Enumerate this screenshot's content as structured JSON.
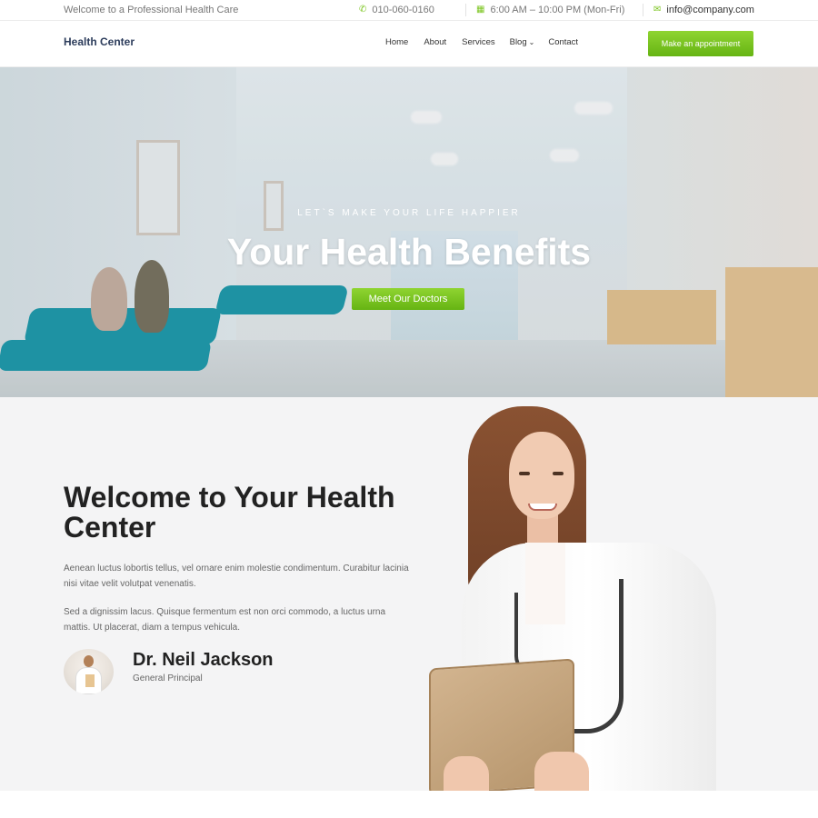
{
  "topbar": {
    "welcome": "Welcome to a Professional Health Care",
    "phone": "010-060-0160",
    "hours": "6:00 AM – 10:00 PM (Mon-Fri)",
    "email": "info@company.com",
    "phone_icon": "phone-icon",
    "calendar_icon": "calendar-icon",
    "mail_icon": "mail-icon"
  },
  "nav": {
    "brand": "Health Center",
    "items": [
      "Home",
      "About",
      "Services",
      "Blog",
      "Contact"
    ],
    "cta": "Make an appointment"
  },
  "hero": {
    "kicker": "LET`S MAKE YOUR LIFE HAPPIER",
    "title": "Your Health Benefits",
    "button": "Meet Our Doctors"
  },
  "about": {
    "heading_line1": "Welcome to Your Health",
    "heading_line2": "Center",
    "paragraph1": "Aenean luctus lobortis tellus, vel ornare enim molestie condimentum. Curabitur lacinia nisi vitae velit volutpat venenatis.",
    "paragraph2": "Sed a dignissim lacus. Quisque fermentum est non orci commodo, a luctus urna mattis. Ut placerat, diam a tempus vehicula.",
    "doctor_name": "Dr. Neil Jackson",
    "doctor_role": "General Principal"
  },
  "colors": {
    "accent": "#7cc520",
    "brand_text": "#2d3d5c",
    "section_bg": "#f4f4f5"
  }
}
